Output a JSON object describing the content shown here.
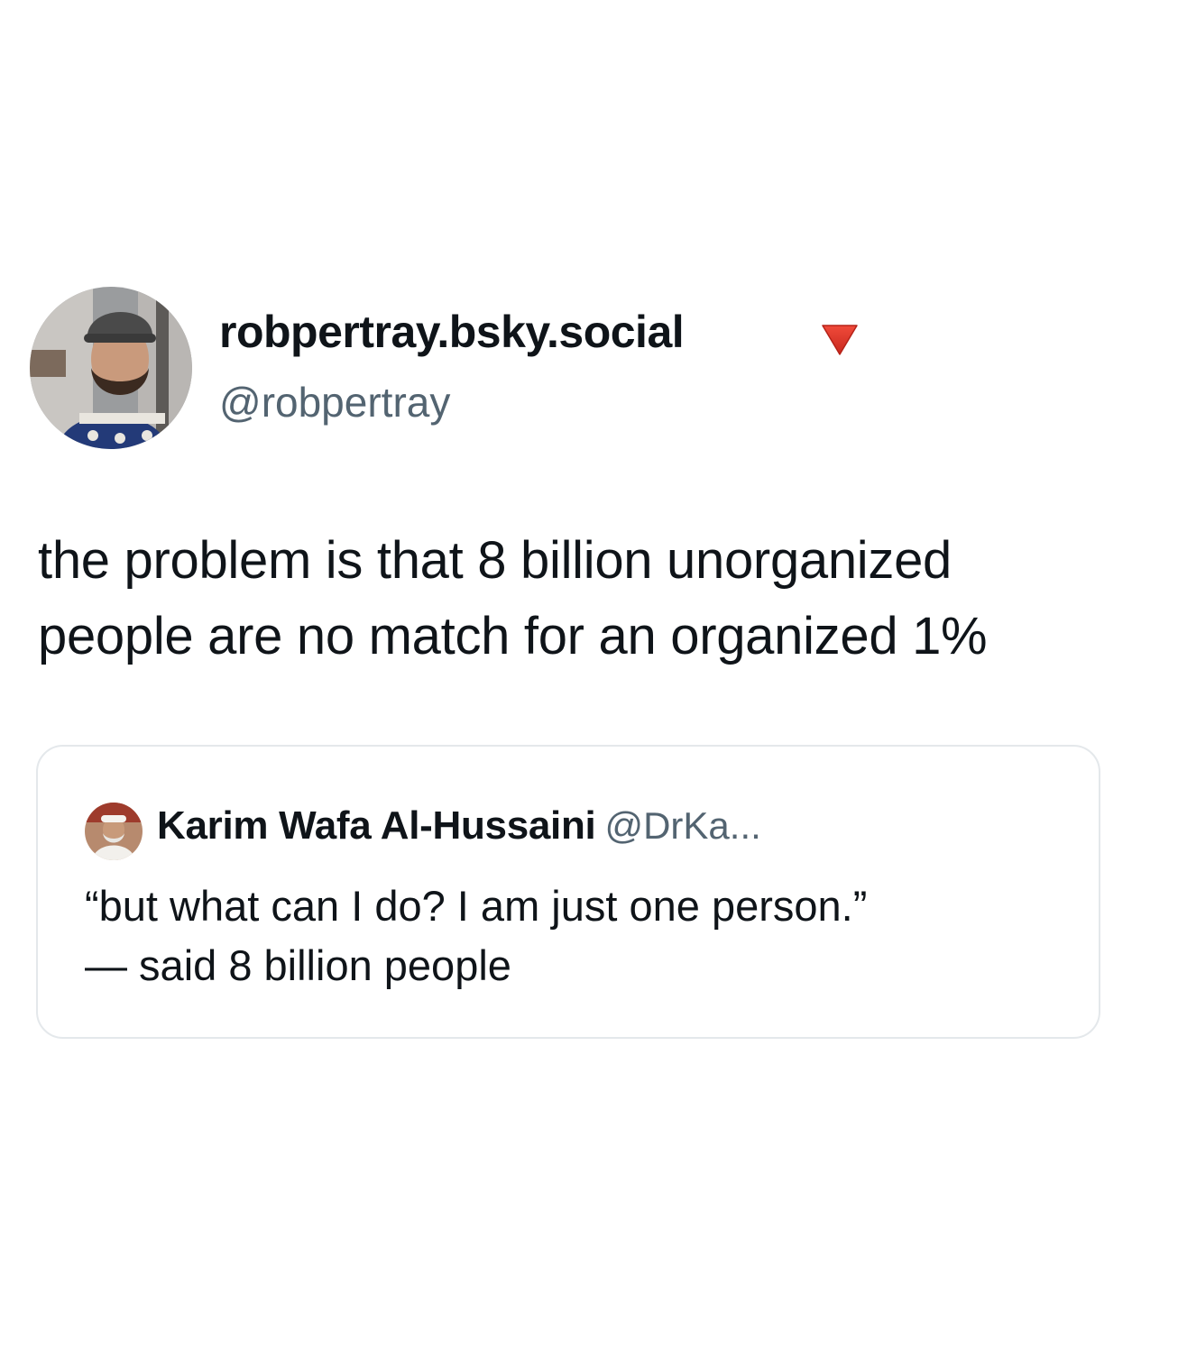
{
  "author": {
    "display_name": "robpertray.bsky.social",
    "handle": "@robpertray",
    "badge_icon": "red-triangle-down-icon",
    "badge_color": "#e8392b"
  },
  "tweet": {
    "lines": [
      "the problem is that 8 billion unorganized",
      "people are no match for an organized 1%"
    ]
  },
  "quote": {
    "display_name": "Karim Wafa Al-Hussaini",
    "handle": "@DrKa...",
    "lines": [
      "“but what can I do? I am just one person.”",
      "— said 8 billion people"
    ]
  },
  "colors": {
    "text": "#0f1419",
    "secondary_text": "#536471",
    "card_border": "#e4e8eb",
    "background": "#ffffff"
  }
}
